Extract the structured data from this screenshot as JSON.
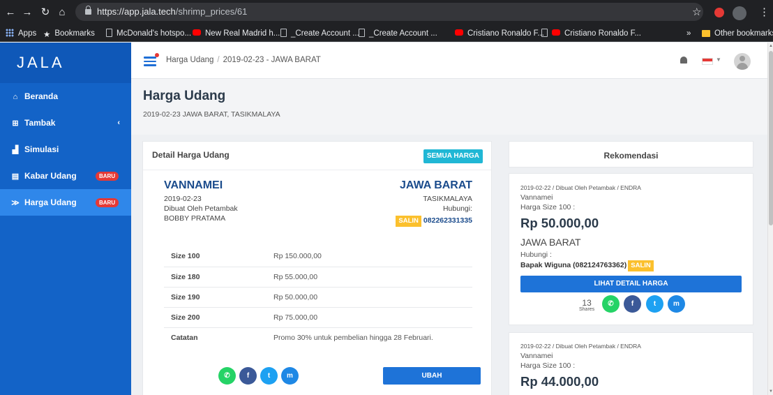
{
  "browser": {
    "url_host": "https://app.jala.tech",
    "url_path": "/shrimp_prices/61",
    "bookmarks": [
      {
        "label": "Apps",
        "icon": "apps-icon"
      },
      {
        "label": "Bookmarks",
        "icon": "star-icon"
      },
      {
        "label": "McDonald's hotspo...",
        "icon": "page-icon"
      },
      {
        "label": "New Real Madrid h...",
        "icon": "youtube-icon"
      },
      {
        "label": "_Create Account ...",
        "icon": "page-icon"
      },
      {
        "label": "_Create Account ...",
        "icon": "page-icon"
      },
      {
        "label": "Cristiano Ronaldo F...",
        "icon": "youtube-icon"
      },
      {
        "label": "Cristiano Ronaldo F...",
        "icon": "youtube-icon"
      }
    ],
    "overflow_label": "»",
    "other_bookmarks": "Other bookmarks"
  },
  "app": {
    "logo": "JALA",
    "brand_color": "#1363c7"
  },
  "sidebar": {
    "items": [
      {
        "label": "Beranda",
        "icon": "home-icon"
      },
      {
        "label": "Tambak",
        "icon": "grid-icon",
        "chevron": "‹"
      },
      {
        "label": "Simulasi",
        "icon": "chart-icon"
      },
      {
        "label": "Kabar Udang",
        "icon": "news-icon",
        "badge": "BARU"
      },
      {
        "label": "Harga Udang",
        "icon": "shrimp-icon",
        "badge": "BARU",
        "active": true
      }
    ]
  },
  "header": {
    "breadcrumb": [
      "Harga Udang",
      "2019-02-23 - JAWA BARAT"
    ]
  },
  "page": {
    "title": "Harga Udang",
    "subtitle": "2019-02-23 JAWA BARAT, TASIKMALAYA"
  },
  "detail": {
    "card_title": "Detail Harga Udang",
    "all_prices_button": "SEMUA HARGA",
    "species": "VANNAMEI",
    "date": "2019-02-23",
    "created_by": "Dibuat Oleh Petambak",
    "farmer_name": "BOBBY PRATAMA",
    "region": "JAWA BARAT",
    "city": "TASIKMALAYA",
    "contact_label": "Hubungi:",
    "copy_label": "SALIN",
    "phone": "082262331335",
    "prices": [
      {
        "label": "Size 100",
        "value": "Rp 150.000,00"
      },
      {
        "label": "Size 180",
        "value": "Rp 55.000,00"
      },
      {
        "label": "Size 190",
        "value": "Rp 50.000,00"
      },
      {
        "label": "Size 200",
        "value": "Rp 75.000,00"
      },
      {
        "label": "Catatan",
        "value": "Promo 30% untuk pembelian hingga 28 Februari."
      }
    ],
    "edit_button": "UBAH"
  },
  "recommendations": {
    "title": "Rekomendasi",
    "items": [
      {
        "meta": "2019-02-22 / Dibuat Oleh Petambak / ENDRA",
        "species": "Vannamei",
        "size_label": "Harga Size 100 :",
        "price": "Rp 50.000,00",
        "region": "JAWA BARAT",
        "contact_label": "Hubungi :",
        "contact": "Bapak Wiguna (082124763362)",
        "copy_label": "SALIN",
        "detail_button": "LIHAT DETAIL HARGA",
        "shares_count": "13",
        "shares_label": "Shares"
      },
      {
        "meta": "2019-02-22 / Dibuat Oleh Petambak / ENDRA",
        "species": "Vannamei",
        "size_label": "Harga Size 100 :",
        "price": "Rp 44.000,00"
      }
    ]
  }
}
